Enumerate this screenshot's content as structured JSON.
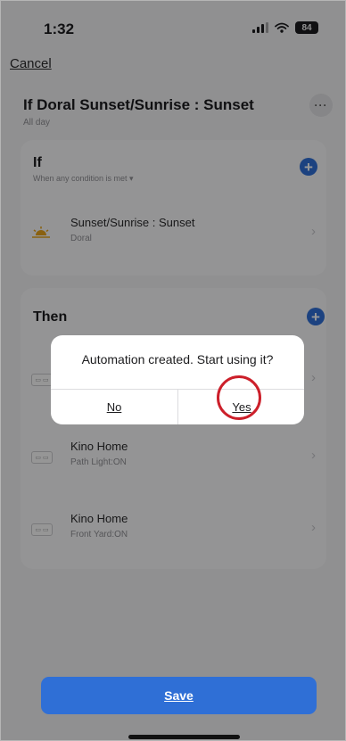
{
  "status_bar": {
    "time": "1:32",
    "battery": "84"
  },
  "nav": {
    "cancel_label": "Cancel",
    "more_label": "···"
  },
  "header": {
    "title": "If Doral Sunset/Sunrise : Sunset",
    "subtitle": "All day"
  },
  "if_section": {
    "title": "If",
    "subtitle": "When any condition is met ▾",
    "conditions": [
      {
        "name": "Sunset/Sunrise : Sunset",
        "detail": "Doral"
      }
    ]
  },
  "then_section": {
    "title": "Then",
    "actions": [
      {
        "name": "Kino Home",
        "detail": "Path Light:ON"
      },
      {
        "name": "Kino Home",
        "detail": "Front Yard:ON"
      }
    ]
  },
  "dialog": {
    "message": "Automation created. Start using it?",
    "no_label": "No",
    "yes_label": "Yes"
  },
  "save_label": "Save",
  "colors": {
    "accent": "#2f6fd6",
    "highlight_ring": "#cc1f2a",
    "sun": "#e6a21a"
  },
  "icons": {
    "plus": "+",
    "chevron": "›",
    "device": "▭ ▭"
  }
}
